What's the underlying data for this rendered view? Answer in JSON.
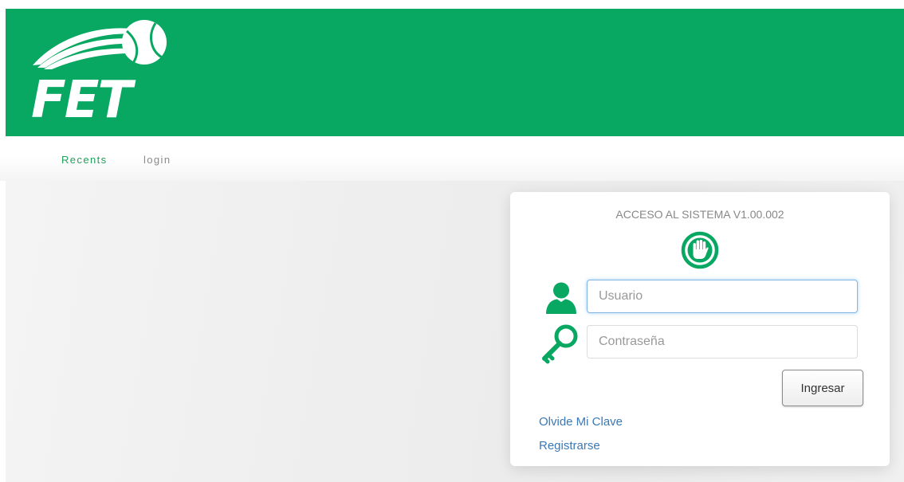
{
  "colors": {
    "brand_green": "#09a862",
    "link_blue": "#3a78b6"
  },
  "header": {
    "logo_text": "FET",
    "logo_icon": "tennis-ball-logo"
  },
  "nav": {
    "items": [
      {
        "label": "Recents"
      },
      {
        "label": "login"
      }
    ]
  },
  "login": {
    "title": "ACCESO AL SISTEMA V1.00.002",
    "stop_icon": "hand-stop-icon",
    "user_icon": "user-icon",
    "key_icon": "key-icon",
    "username": {
      "value": "",
      "placeholder": "Usuario"
    },
    "password": {
      "value": "",
      "placeholder": "Contraseña"
    },
    "submit_label": "Ingresar",
    "forgot_link": "Olvide Mi Clave",
    "register_link": "Registrarse"
  }
}
